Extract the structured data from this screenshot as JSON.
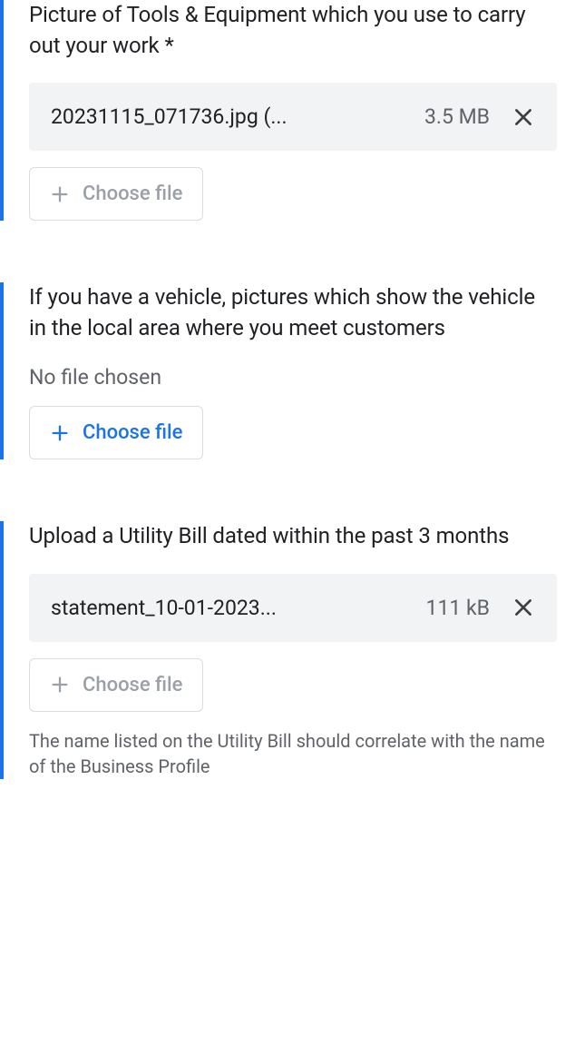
{
  "sections": [
    {
      "label": "Picture of Tools & Equipment which you use to carry out your work *",
      "file": {
        "name": "20231115_071736.jpg (...",
        "size": "3.5 MB"
      },
      "choose_label": "Choose file",
      "choose_state": "disabled"
    },
    {
      "label": "If you have a vehicle, pictures which show the vehicle in the local area where you meet customers",
      "no_file_text": "No file chosen",
      "choose_label": "Choose file",
      "choose_state": "active"
    },
    {
      "label": "Upload a Utility Bill dated within the past 3 months",
      "file": {
        "name": "statement_10-01-2023...",
        "size": "111 kB"
      },
      "choose_label": "Choose file",
      "choose_state": "disabled",
      "helper": "The name listed on the Utility Bill should correlate with the name of the Business Profile"
    }
  ]
}
